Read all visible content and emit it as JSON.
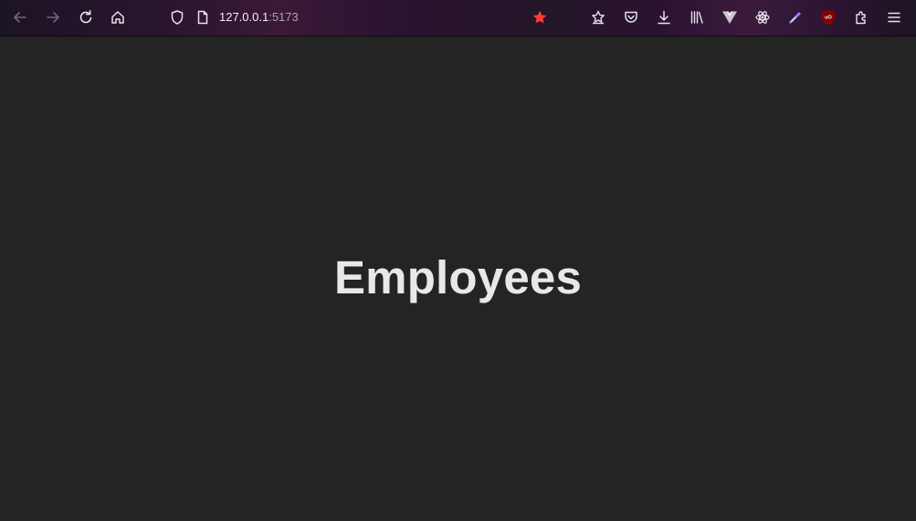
{
  "browser": {
    "address": {
      "host": "127.0.0.1",
      "port": ":5173"
    },
    "icons": {
      "back": "back-arrow-icon",
      "forward": "forward-arrow-icon",
      "reload": "reload-icon",
      "home": "home-icon",
      "tracking": "shield-icon",
      "page": "page-icon",
      "bookmark": "bookmark-star-icon",
      "toolbar": [
        "extensions-star-icon",
        "pocket-icon",
        "downloads-icon",
        "library-icon",
        "vue-devtools-icon",
        "react-devtools-icon",
        "color-picker-icon",
        "ublock-origin-icon",
        "extensions-puzzle-icon",
        "menu-icon"
      ]
    },
    "colors": {
      "bookmark_star": "#ff3b3b",
      "toolbar_icon": "#e6e3ea",
      "disabled_icon": "#6e6878"
    }
  },
  "page": {
    "title": "Employees",
    "background": "#242424",
    "text_color": "#e8e8e8"
  }
}
